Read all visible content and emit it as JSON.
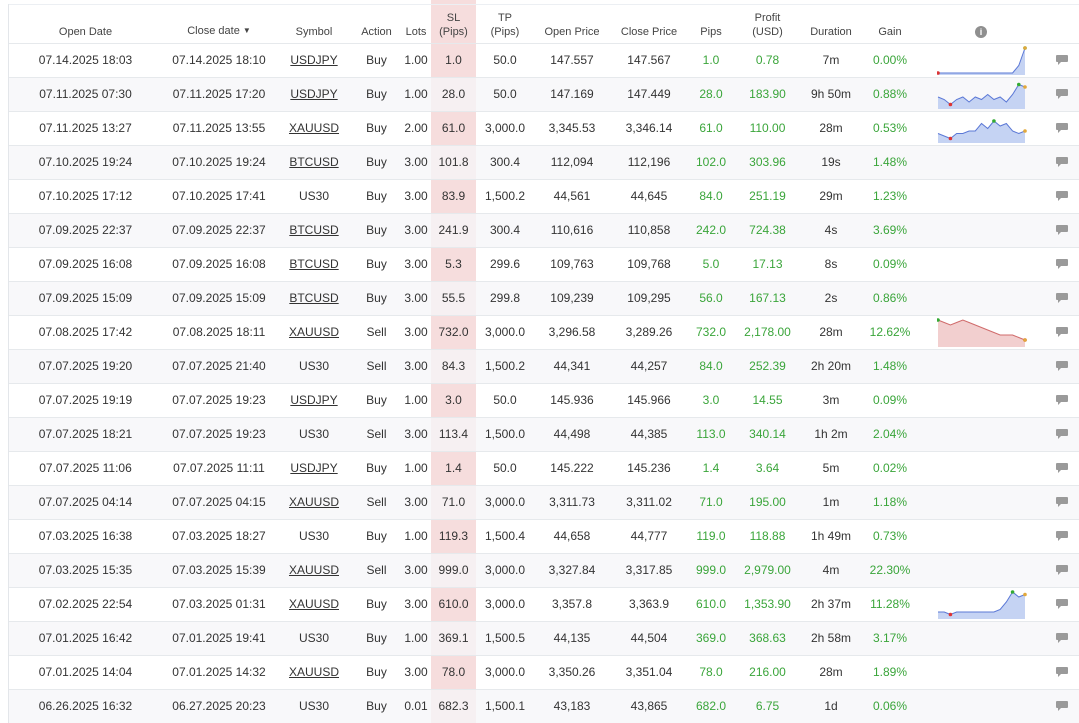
{
  "headers": {
    "open_date": "Open Date",
    "close_date": "Close date",
    "close_sort_indicator": "▼",
    "symbol": "Symbol",
    "action": "Action",
    "lots": "Lots",
    "sl": "SL",
    "sl_unit": "(Pips)",
    "tp": "TP",
    "tp_unit": "(Pips)",
    "open_price": "Open Price",
    "close_price": "Close Price",
    "pips": "Pips",
    "profit": "Profit",
    "profit_unit": "(USD)",
    "duration": "Duration",
    "gain": "Gain",
    "info_glyph": "i"
  },
  "colors": {
    "sl_band": "#f6dddd",
    "positive": "#3aa53a",
    "spark_up": "#c5d3f3",
    "spark_down": "#f2cfcf"
  },
  "icons": {
    "info": "info-icon",
    "comment": "comment-icon"
  },
  "rows": [
    {
      "open": "07.14.2025 18:03",
      "close": "07.14.2025 18:10",
      "symbol": "USDJPY",
      "link": true,
      "action": "Buy",
      "lots": "1.00",
      "sl": "1.0",
      "tp": "50.0",
      "open_price": "147.557",
      "close_price": "147.567",
      "pips": "1.0",
      "profit": "0.78",
      "duration": "7m",
      "gain": "0.00%",
      "spark": {
        "points": [
          0,
          0,
          0,
          0,
          0,
          0,
          0,
          0,
          0,
          0,
          0,
          0,
          0,
          3,
          10
        ],
        "kind": "up"
      }
    },
    {
      "open": "07.11.2025 07:30",
      "close": "07.11.2025 17:20",
      "symbol": "USDJPY",
      "link": true,
      "action": "Buy",
      "lots": "1.00",
      "sl": "28.0",
      "tp": "50.0",
      "open_price": "147.169",
      "close_price": "147.449",
      "pips": "28.0",
      "profit": "183.90",
      "duration": "9h 50m",
      "gain": "0.88%",
      "spark": {
        "points": [
          4,
          3,
          1,
          3,
          4,
          2,
          4,
          3,
          5,
          3,
          4,
          2,
          5,
          9,
          8
        ],
        "kind": "up"
      }
    },
    {
      "open": "07.11.2025 13:27",
      "close": "07.11.2025 13:55",
      "symbol": "XAUUSD",
      "link": true,
      "action": "Buy",
      "lots": "2.00",
      "sl": "61.0",
      "tp": "3,000.0",
      "open_price": "3,345.53",
      "close_price": "3,346.14",
      "pips": "61.0",
      "profit": "110.00",
      "duration": "28m",
      "gain": "0.53%",
      "spark": {
        "points": [
          3,
          2,
          1,
          3,
          3,
          4,
          4,
          7,
          5,
          8,
          6,
          7,
          4,
          3,
          4
        ],
        "kind": "up"
      }
    },
    {
      "open": "07.10.2025 19:24",
      "close": "07.10.2025 19:24",
      "symbol": "BTCUSD",
      "link": true,
      "action": "Buy",
      "lots": "3.00",
      "sl": "101.8",
      "tp": "300.4",
      "open_price": "112,094",
      "close_price": "112,196",
      "pips": "102.0",
      "profit": "303.96",
      "duration": "19s",
      "gain": "1.48%",
      "spark": null
    },
    {
      "open": "07.10.2025 17:12",
      "close": "07.10.2025 17:41",
      "symbol": "US30",
      "link": false,
      "action": "Buy",
      "lots": "3.00",
      "sl": "83.9",
      "tp": "1,500.2",
      "open_price": "44,561",
      "close_price": "44,645",
      "pips": "84.0",
      "profit": "251.19",
      "duration": "29m",
      "gain": "1.23%",
      "spark": null
    },
    {
      "open": "07.09.2025 22:37",
      "close": "07.09.2025 22:37",
      "symbol": "BTCUSD",
      "link": true,
      "action": "Buy",
      "lots": "3.00",
      "sl": "241.9",
      "tp": "300.4",
      "open_price": "110,616",
      "close_price": "110,858",
      "pips": "242.0",
      "profit": "724.38",
      "duration": "4s",
      "gain": "3.69%",
      "spark": null
    },
    {
      "open": "07.09.2025 16:08",
      "close": "07.09.2025 16:08",
      "symbol": "BTCUSD",
      "link": true,
      "action": "Buy",
      "lots": "3.00",
      "sl": "5.3",
      "tp": "299.6",
      "open_price": "109,763",
      "close_price": "109,768",
      "pips": "5.0",
      "profit": "17.13",
      "duration": "8s",
      "gain": "0.09%",
      "spark": null
    },
    {
      "open": "07.09.2025 15:09",
      "close": "07.09.2025 15:09",
      "symbol": "BTCUSD",
      "link": true,
      "action": "Buy",
      "lots": "3.00",
      "sl": "55.5",
      "tp": "299.8",
      "open_price": "109,239",
      "close_price": "109,295",
      "pips": "56.0",
      "profit": "167.13",
      "duration": "2s",
      "gain": "0.86%",
      "spark": null
    },
    {
      "open": "07.08.2025 17:42",
      "close": "07.08.2025 18:11",
      "symbol": "XAUUSD",
      "link": true,
      "action": "Sell",
      "lots": "3.00",
      "sl": "732.0",
      "tp": "3,000.0",
      "open_price": "3,296.58",
      "close_price": "3,289.26",
      "pips": "732.0",
      "profit": "2,178.00",
      "duration": "28m",
      "gain": "12.62%",
      "spark": {
        "points": [
          10,
          9,
          8,
          9,
          10,
          9,
          8,
          7,
          6,
          5,
          4,
          4,
          4,
          3,
          2
        ],
        "kind": "down"
      }
    },
    {
      "open": "07.07.2025 19:20",
      "close": "07.07.2025 21:40",
      "symbol": "US30",
      "link": false,
      "action": "Sell",
      "lots": "3.00",
      "sl": "84.3",
      "tp": "1,500.2",
      "open_price": "44,341",
      "close_price": "44,257",
      "pips": "84.0",
      "profit": "252.39",
      "duration": "2h 20m",
      "gain": "1.48%",
      "spark": null
    },
    {
      "open": "07.07.2025 19:19",
      "close": "07.07.2025 19:23",
      "symbol": "USDJPY",
      "link": true,
      "action": "Buy",
      "lots": "1.00",
      "sl": "3.0",
      "tp": "50.0",
      "open_price": "145.936",
      "close_price": "145.966",
      "pips": "3.0",
      "profit": "14.55",
      "duration": "3m",
      "gain": "0.09%",
      "spark": null
    },
    {
      "open": "07.07.2025 18:21",
      "close": "07.07.2025 19:23",
      "symbol": "US30",
      "link": false,
      "action": "Sell",
      "lots": "3.00",
      "sl": "113.4",
      "tp": "1,500.0",
      "open_price": "44,498",
      "close_price": "44,385",
      "pips": "113.0",
      "profit": "340.14",
      "duration": "1h 2m",
      "gain": "2.04%",
      "spark": null
    },
    {
      "open": "07.07.2025 11:06",
      "close": "07.07.2025 11:11",
      "symbol": "USDJPY",
      "link": true,
      "action": "Buy",
      "lots": "1.00",
      "sl": "1.4",
      "tp": "50.0",
      "open_price": "145.222",
      "close_price": "145.236",
      "pips": "1.4",
      "profit": "3.64",
      "duration": "5m",
      "gain": "0.02%",
      "spark": null
    },
    {
      "open": "07.07.2025 04:14",
      "close": "07.07.2025 04:15",
      "symbol": "XAUUSD",
      "link": true,
      "action": "Sell",
      "lots": "3.00",
      "sl": "71.0",
      "tp": "3,000.0",
      "open_price": "3,311.73",
      "close_price": "3,311.02",
      "pips": "71.0",
      "profit": "195.00",
      "duration": "1m",
      "gain": "1.18%",
      "spark": null
    },
    {
      "open": "07.03.2025 16:38",
      "close": "07.03.2025 18:27",
      "symbol": "US30",
      "link": false,
      "action": "Buy",
      "lots": "1.00",
      "sl": "119.3",
      "tp": "1,500.4",
      "open_price": "44,658",
      "close_price": "44,777",
      "pips": "119.0",
      "profit": "118.88",
      "duration": "1h 49m",
      "gain": "0.73%",
      "spark": null
    },
    {
      "open": "07.03.2025 15:35",
      "close": "07.03.2025 15:39",
      "symbol": "XAUUSD",
      "link": true,
      "action": "Sell",
      "lots": "3.00",
      "sl": "999.0",
      "tp": "3,000.0",
      "open_price": "3,327.84",
      "close_price": "3,317.85",
      "pips": "999.0",
      "profit": "2,979.00",
      "duration": "4m",
      "gain": "22.30%",
      "spark": null
    },
    {
      "open": "07.02.2025 22:54",
      "close": "07.03.2025 01:31",
      "symbol": "XAUUSD",
      "link": true,
      "action": "Buy",
      "lots": "3.00",
      "sl": "610.0",
      "tp": "3,000.0",
      "open_price": "3,357.8",
      "close_price": "3,363.9",
      "pips": "610.0",
      "profit": "1,353.90",
      "duration": "2h 37m",
      "gain": "11.28%",
      "spark": {
        "points": [
          2,
          2,
          1,
          2,
          2,
          2,
          2,
          2,
          2,
          2,
          3,
          6,
          10,
          8,
          9
        ],
        "kind": "up"
      }
    },
    {
      "open": "07.01.2025 16:42",
      "close": "07.01.2025 19:41",
      "symbol": "US30",
      "link": false,
      "action": "Buy",
      "lots": "1.00",
      "sl": "369.1",
      "tp": "1,500.5",
      "open_price": "44,135",
      "close_price": "44,504",
      "pips": "369.0",
      "profit": "368.63",
      "duration": "2h 58m",
      "gain": "3.17%",
      "spark": null
    },
    {
      "open": "07.01.2025 14:04",
      "close": "07.01.2025 14:32",
      "symbol": "XAUUSD",
      "link": true,
      "action": "Buy",
      "lots": "3.00",
      "sl": "78.0",
      "tp": "3,000.0",
      "open_price": "3,350.26",
      "close_price": "3,351.04",
      "pips": "78.0",
      "profit": "216.00",
      "duration": "28m",
      "gain": "1.89%",
      "spark": null
    },
    {
      "open": "06.26.2025 16:32",
      "close": "06.27.2025 20:23",
      "symbol": "US30",
      "link": false,
      "action": "Buy",
      "lots": "0.01",
      "sl": "682.3",
      "tp": "1,500.1",
      "open_price": "43,183",
      "close_price": "43,865",
      "pips": "682.0",
      "profit": "6.75",
      "duration": "1d",
      "gain": "0.06%",
      "spark": null
    }
  ]
}
